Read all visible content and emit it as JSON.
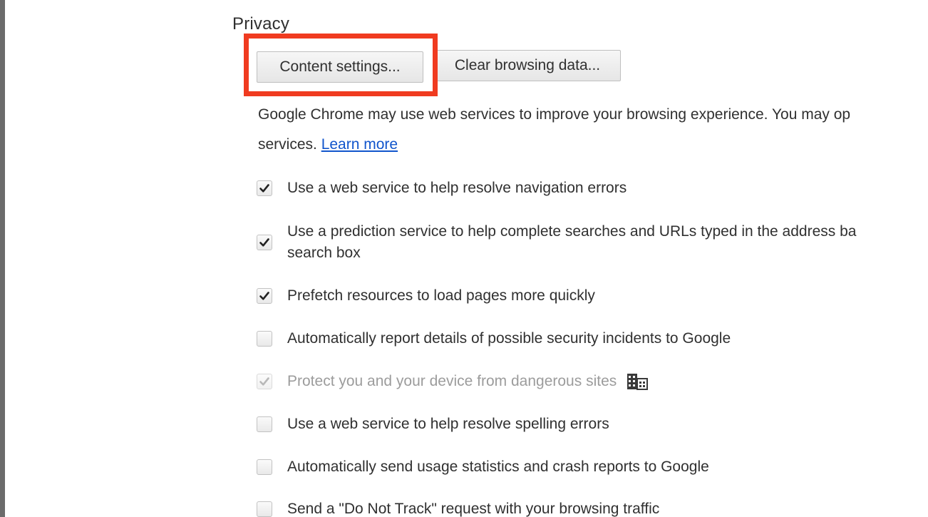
{
  "privacy": {
    "title": "Privacy",
    "content_settings_button": "Content settings...",
    "clear_browsing_button": "Clear browsing data...",
    "description_line1": "Google Chrome may use web services to improve your browsing experience. You may op",
    "description_line2": "services. ",
    "learn_more": "Learn more",
    "highlight_color": "#f03b20",
    "options": [
      {
        "label": "Use a web service to help resolve navigation errors",
        "checked": true,
        "disabled": false
      },
      {
        "label": "Use a prediction service to help complete searches and URLs typed in the address ba",
        "label2": "search box",
        "checked": true,
        "disabled": false
      },
      {
        "label": "Prefetch resources to load pages more quickly",
        "checked": true,
        "disabled": false
      },
      {
        "label": "Automatically report details of possible security incidents to Google",
        "checked": false,
        "disabled": false
      },
      {
        "label": "Protect you and your device from dangerous sites",
        "checked": true,
        "disabled": true,
        "icon": "enterprise-managed-icon"
      },
      {
        "label": "Use a web service to help resolve spelling errors",
        "checked": false,
        "disabled": false
      },
      {
        "label": "Automatically send usage statistics and crash reports to Google",
        "checked": false,
        "disabled": false
      },
      {
        "label": "Send a \"Do Not Track\" request with your browsing traffic",
        "checked": false,
        "disabled": false
      }
    ]
  }
}
